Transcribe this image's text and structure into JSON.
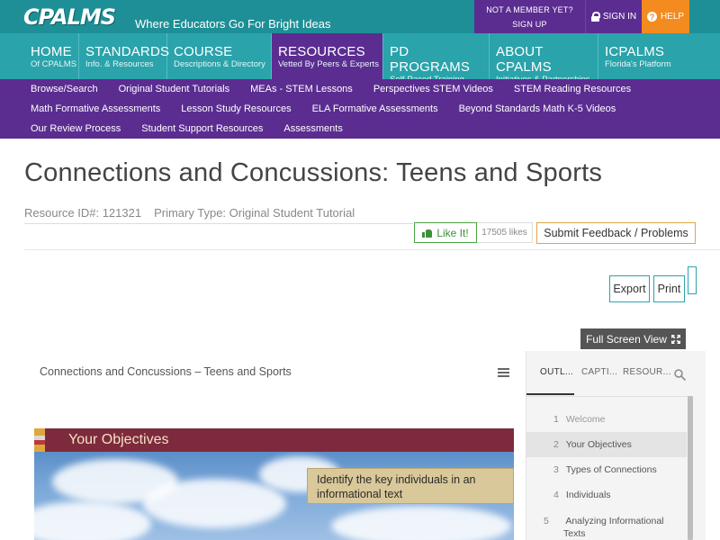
{
  "header": {
    "logo_text": "CPALMS",
    "tagline": "Where Educators Go For Bright Ideas",
    "not_member_line1": "NOT A MEMBER YET?",
    "not_member_line2": "SIGN UP",
    "sign_in": "SIGN IN",
    "help": "HELP",
    "colors": {
      "teal": "#1e8f96",
      "purple": "#5b2d91",
      "orange": "#f38b1f"
    }
  },
  "main_nav": [
    {
      "title": "HOME",
      "subtitle": "Of CPALMS"
    },
    {
      "title": "STANDARDS",
      "subtitle": "Info. & Resources"
    },
    {
      "title": "COURSE",
      "subtitle": "Descriptions & Directory"
    },
    {
      "title": "RESOURCES",
      "subtitle": "Vetted By Peers & Experts",
      "active": true
    },
    {
      "title": "PD PROGRAMS",
      "subtitle": "Self-Paced Training"
    },
    {
      "title": "ABOUT CPALMS",
      "subtitle": "Initiatives & Partnerships"
    },
    {
      "title": "ICPALMS",
      "subtitle": "Florida's Platform"
    }
  ],
  "sub_nav": {
    "row1": [
      "Browse/Search",
      "Original Student Tutorials",
      "MEAs - STEM Lessons",
      "Perspectives STEM Videos",
      "STEM Reading Resources"
    ],
    "row2": [
      "Math Formative Assessments",
      "Lesson Study Resources",
      "ELA Formative Assessments",
      "Beyond Standards Math K-5 Videos"
    ],
    "row3": [
      "Our Review Process",
      "Student Support Resources",
      "Assessments"
    ]
  },
  "resource": {
    "title": "Connections and Concussions: Teens and Sports",
    "id_label": "Resource ID#: 121321",
    "type_label": "Primary Type: Original Student Tutorial",
    "like_label": "Like It!",
    "like_count": "17505 likes",
    "feedback_label": "Submit Feedback / Problems",
    "export_label": "Export",
    "print_label": "Print",
    "fullscreen_label": "Full Screen View"
  },
  "player": {
    "title": "Connections and Concussions – Teens and Sports",
    "slide_heading": "Your Objectives",
    "objective_text": "Identify the key individuals in an informational text",
    "tabs": {
      "outline": "OUTL...",
      "captions": "CAPTI...",
      "resources": "RESOUR..."
    },
    "outline": [
      {
        "num": "1",
        "label": "Welcome"
      },
      {
        "num": "2",
        "label": "Your Objectives"
      },
      {
        "num": "3",
        "label": "Types of Connections"
      },
      {
        "num": "4",
        "label": "Individuals"
      },
      {
        "num": "5",
        "label": "Analyzing Informational Texts"
      }
    ]
  }
}
